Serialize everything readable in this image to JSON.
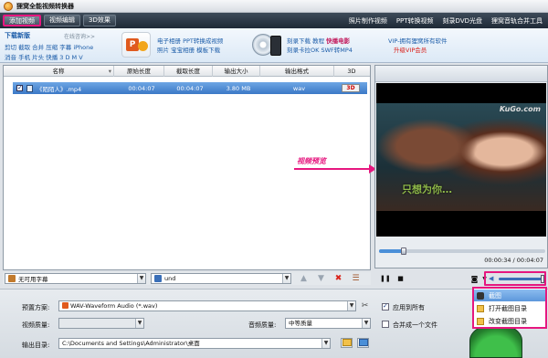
{
  "app": {
    "title": "狸窝全能视频转换器"
  },
  "menubar": {
    "tabs": [
      "添加视频",
      "视频编辑",
      "3D效果"
    ],
    "links": [
      "照片制作视频",
      "PPT转换视频",
      "刻录DVD光盘",
      "狸窝音轨合并工具"
    ]
  },
  "banner": {
    "download_title": "下载新版",
    "download_more": "在线咨询>>",
    "download_line1": "剪切 截取 合并 压缩 字幕 iPhone",
    "download_line2": "消音 手机 片头 快播 3 D M V",
    "promo1_line1": "电子相册 PPT转换成视频",
    "promo1_line2": "照片 宝宝相册 模板下载",
    "promo2_line1": "刻录下载 教程 ",
    "promo2_highlight": "快播电影",
    "promo2_line2": "刻录卡拉OK SWF转MP4",
    "vip_line1": "VIP-拥有狸窝所有软件",
    "vip_line2": "升级VIP会员"
  },
  "list": {
    "columns": [
      "名称",
      "原始长度",
      "截取长度",
      "输出大小",
      "输出格式",
      "3D"
    ],
    "rows": [
      {
        "name": "《陌陌人》.mp4",
        "duration": "00:04:07",
        "cut": "00:04:07",
        "size": "3.80 MB",
        "format": "wav",
        "tag_3d": "3D"
      }
    ]
  },
  "annotation": {
    "label": "视频预览"
  },
  "preview": {
    "watermark": "KuGo.com",
    "subtitle": "只想为你…",
    "time": "00:00:34 / 00:04:07",
    "progress": 0.15,
    "volume": 1.0
  },
  "subtoolbar": {
    "subtitle_value": "无可用字幕",
    "audio_value": "und"
  },
  "settings": {
    "preset_label": "预置方案:",
    "preset_value": "WAV-Waveform Audio (*.wav)",
    "video_quality_label": "视频质量:",
    "video_quality_value": "",
    "audio_quality_label": "音频质量:",
    "audio_quality_value": "中等质量",
    "output_dir_label": "输出目录:",
    "output_dir_value": "C:\\Documents and Settings\\Administrator\\桌面",
    "apply_all_label": "应用到所有",
    "apply_all_checked": true,
    "merge_label": "合并成一个文件",
    "merge_checked": false
  },
  "popup": {
    "items": [
      "截图",
      "打开截图目录",
      "改变截图目录"
    ],
    "selected_index": 0
  },
  "colors": {
    "accent": "#e6177f",
    "selection": "#3b78c6",
    "menubar": "#2c3844"
  }
}
